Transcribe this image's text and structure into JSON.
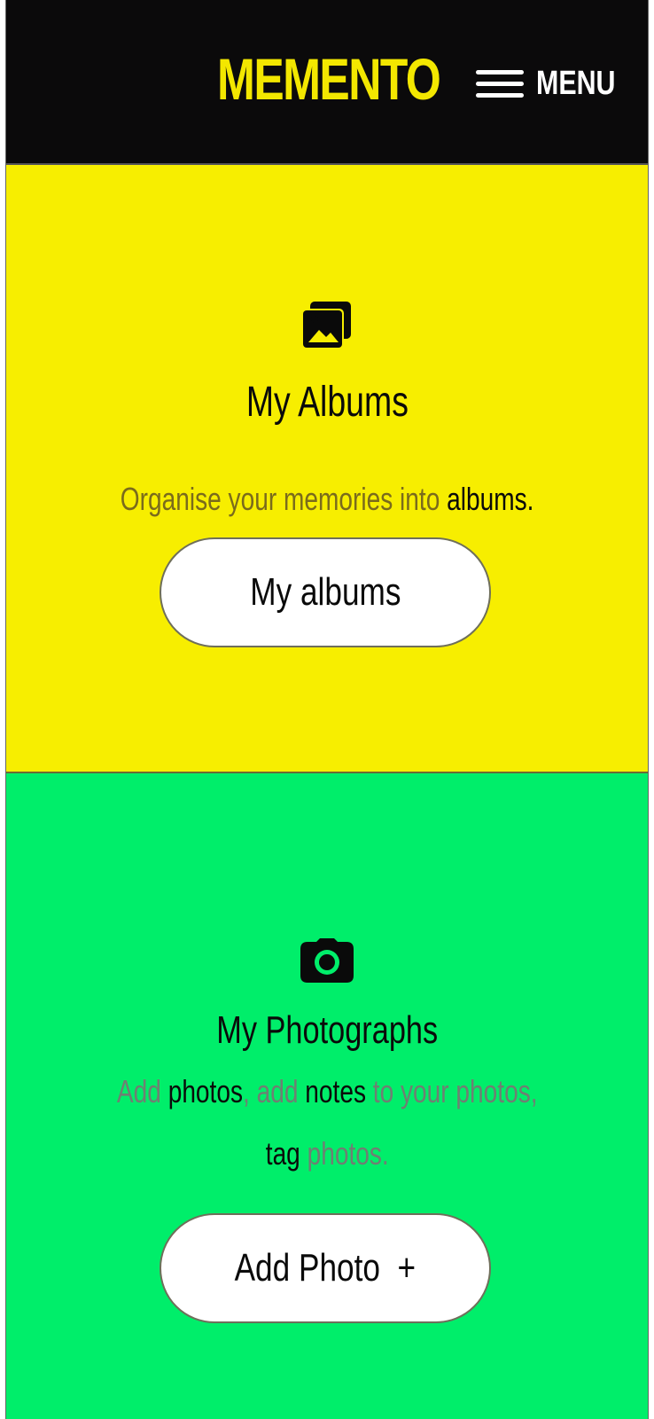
{
  "header": {
    "logo": "MEMENTO",
    "menu_label": "MENU"
  },
  "albums": {
    "icon": "images-icon",
    "title": "My Albums",
    "description_parts": [
      "Organise your memories into ",
      "albums."
    ],
    "button_label": "My albums"
  },
  "photos": {
    "icon": "camera-icon",
    "title": "My Photographs",
    "description_parts": [
      "Add",
      " photos",
      ",",
      " add",
      " notes",
      " to your photos,",
      "tag",
      " photos."
    ],
    "button_label": "Add Photo  +"
  },
  "colors": {
    "header_bg": "#0b0a0b",
    "logo": "#f3e700",
    "albums_bg": "#f7ee00",
    "photos_bg": "#00ee6a",
    "button_bg": "#ffffff"
  }
}
